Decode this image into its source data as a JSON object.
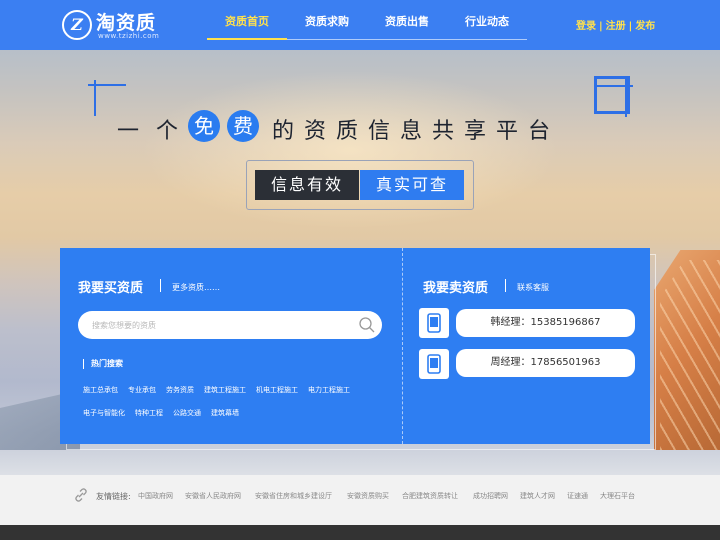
{
  "header": {
    "logo_mark": "Z",
    "logo_name": "淘资质",
    "logo_url": "www.tzizhi.com",
    "nav": [
      "资质首页",
      "资质求购",
      "资质出售",
      "行业动态"
    ],
    "auth": {
      "login": "登录",
      "register": "注册",
      "publish": "发布",
      "separator": "|"
    }
  },
  "hero": {
    "slogan": [
      "一",
      "个",
      "免",
      "费",
      "的",
      "资",
      "质",
      "信",
      "息",
      "共",
      "享",
      "平",
      "台"
    ],
    "tag_dark": "信息有效",
    "tag_blue": "真实可查"
  },
  "buy": {
    "title": "我要买资质",
    "more": "更多资质……",
    "search_placeholder": "搜索您想要的资质",
    "hot_title": "热门搜索",
    "hot_items": [
      "施工总承包",
      "专业承包",
      "劳务资质",
      "建筑工程施工",
      "机电工程施工",
      "电力工程施工",
      "电子与智能化",
      "特种工程",
      "公路交通",
      "建筑幕墙"
    ]
  },
  "sell": {
    "title": "我要卖资质",
    "service": "联系客服",
    "contacts": [
      "韩经理：15385196867",
      "周经理：17856501963"
    ]
  },
  "footer": {
    "label": "友情链接:",
    "links": [
      "中国政府网",
      "安徽省人民政府网",
      "安徽省住房和城乡建设厅",
      "安徽资质购买",
      "合肥建筑资质转让",
      "成功招聘网",
      "建筑人才网",
      "证速通",
      "大理石平台"
    ]
  },
  "colors": {
    "primary": "#3b7ff2",
    "accent_yellow": "#ffe14d",
    "dark": "#2b2f36"
  }
}
